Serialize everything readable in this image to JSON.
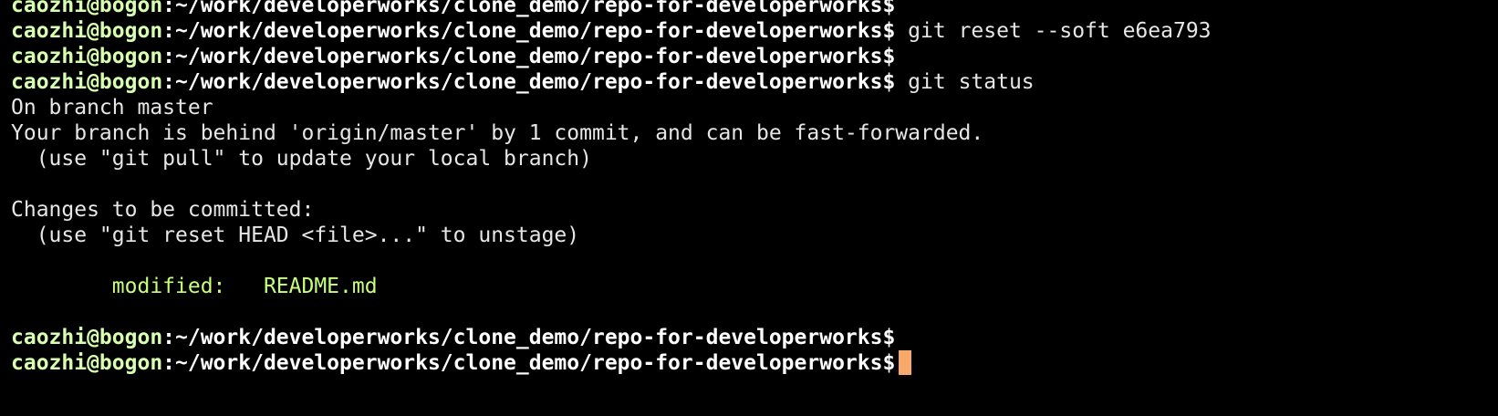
{
  "colors": {
    "background": "#000000",
    "prompt_user": "#d7ffaf",
    "prompt_path": "#ffffff",
    "text": "#e6e6e6",
    "modified": "#c8ff7a",
    "cursor": "#f6a96a"
  },
  "prompt": {
    "user": "caozhi@bogon",
    "path": ":~/work/developerworks/clone_demo/repo-for-developerworks",
    "symbol": "$"
  },
  "lines": [
    {
      "kind": "prompt",
      "command": ""
    },
    {
      "kind": "prompt",
      "command": " git reset --soft e6ea793"
    },
    {
      "kind": "prompt",
      "command": ""
    },
    {
      "kind": "prompt",
      "command": " git status"
    },
    {
      "kind": "output",
      "text": "On branch master"
    },
    {
      "kind": "output",
      "text": "Your branch is behind 'origin/master' by 1 commit, and can be fast-forwarded."
    },
    {
      "kind": "output",
      "text": "  (use \"git pull\" to update your local branch)"
    },
    {
      "kind": "blank",
      "text": ""
    },
    {
      "kind": "output",
      "text": "Changes to be committed:"
    },
    {
      "kind": "output",
      "text": "  (use \"git reset HEAD <file>...\" to unstage)"
    },
    {
      "kind": "blank",
      "text": ""
    },
    {
      "kind": "modified",
      "text": "\tmodified:   README.md"
    },
    {
      "kind": "blank",
      "text": ""
    },
    {
      "kind": "prompt",
      "command": ""
    },
    {
      "kind": "prompt",
      "command": " ",
      "cursor": true
    }
  ]
}
